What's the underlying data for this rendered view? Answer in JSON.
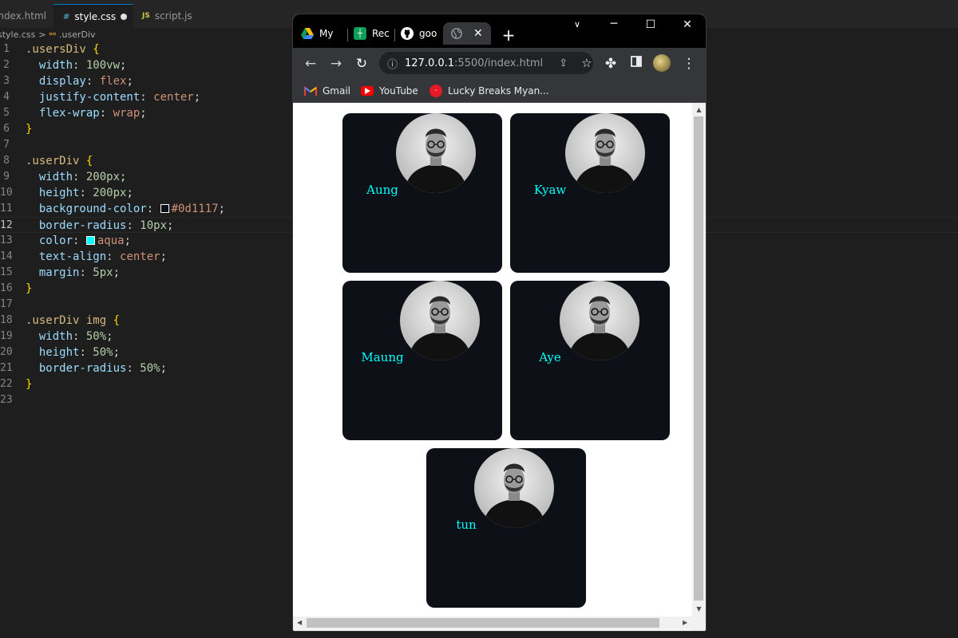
{
  "editor": {
    "tabs": [
      {
        "label": "index.html",
        "icon": "html-file-icon"
      },
      {
        "label": "style.css",
        "icon": "css-file-icon",
        "prefix": "#",
        "modified": true
      },
      {
        "label": "script.js",
        "icon": "js-file-icon",
        "prefix": "JS"
      }
    ],
    "breadcrumb": {
      "file": "style.css",
      "separator": ">",
      "symbol": ".userDiv"
    },
    "current_line": 12,
    "line_numbers": [
      "1",
      "2",
      "3",
      "4",
      "5",
      "6",
      "7",
      "8",
      "9",
      "10",
      "11",
      "12",
      "13",
      "14",
      "15",
      "16",
      "17",
      "18",
      "19",
      "20",
      "21",
      "22",
      "23"
    ],
    "code": {
      "l1_sel": ".usersDiv",
      "l2_prop": "width",
      "l2_val": "100vw",
      "l3_prop": "display",
      "l3_val": "flex",
      "l4_prop": "justify-content",
      "l4_val": "center",
      "l5_prop": "flex-wrap",
      "l5_val": "wrap",
      "l8_sel": ".userDiv",
      "l9_prop": "width",
      "l9_val": "200px",
      "l10_prop": "height",
      "l10_val": "200px",
      "l11_prop": "background-color",
      "l11_val": "#0d1117",
      "l12_prop": "border-radius",
      "l12_val": "10px",
      "l13_prop": "color",
      "l13_val": "aqua",
      "l14_prop": "text-align",
      "l14_val": "center",
      "l15_prop": "margin",
      "l15_val": "5px",
      "l18_sel": ".userDiv img",
      "l19_prop": "width",
      "l19_val": "50%",
      "l20_prop": "height",
      "l20_val": "50%",
      "l21_prop": "border-radius",
      "l21_val": "50%"
    },
    "colors": {
      "swatch_bg": "#0d1117",
      "swatch_aqua": "#00ffff"
    }
  },
  "browser": {
    "tabs": [
      {
        "label": "My",
        "icon": "google-drive-icon"
      },
      {
        "label": "Rec",
        "icon": "google-sheets-icon"
      },
      {
        "label": "goo",
        "icon": "github-icon"
      },
      {
        "label": "",
        "icon": "globe-icon",
        "active": true
      }
    ],
    "address": {
      "host": "127.0.0.1",
      "path": ":5500/index.html"
    },
    "bookmarks": [
      {
        "label": "Gmail",
        "icon": "gmail-icon"
      },
      {
        "label": "YouTube",
        "icon": "youtube-icon"
      },
      {
        "label": "Lucky Breaks Myan...",
        "icon": "coca-cola-icon"
      }
    ]
  },
  "users": [
    {
      "name": "Aung"
    },
    {
      "name": "Kyaw"
    },
    {
      "name": "Maung"
    },
    {
      "name": "Aye"
    },
    {
      "name": "tun"
    }
  ]
}
